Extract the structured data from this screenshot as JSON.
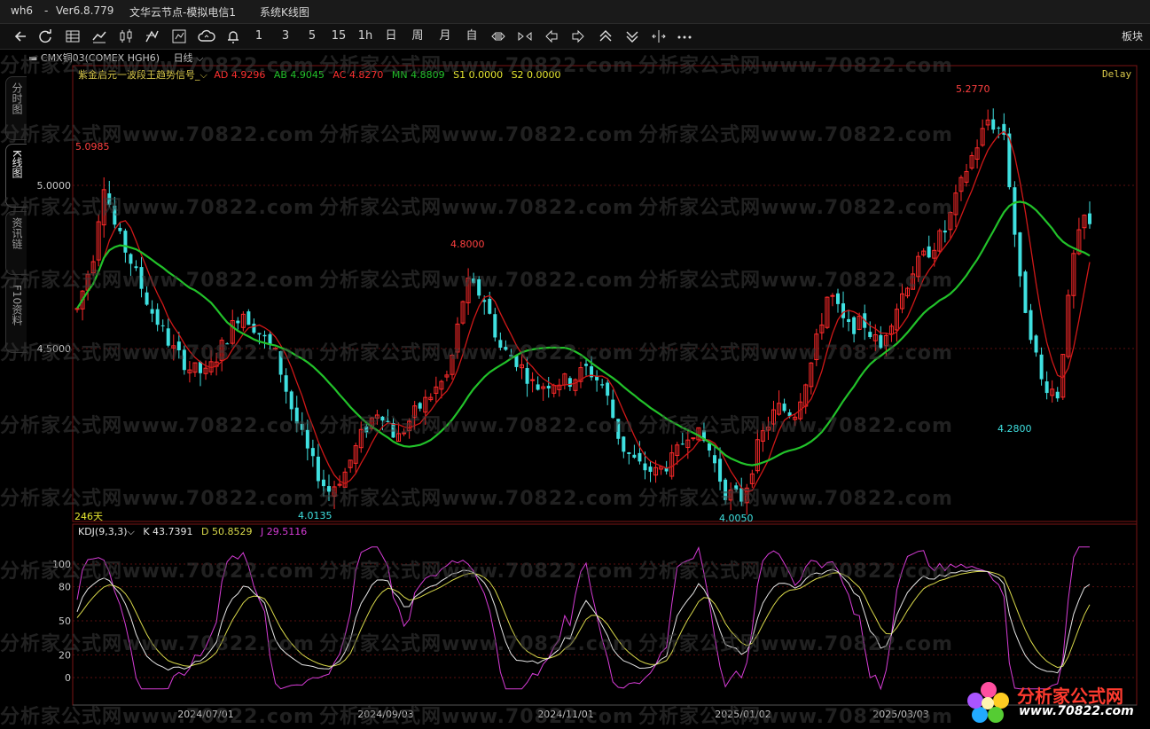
{
  "window": {
    "app": "wh6",
    "sep": "-",
    "version": "Ver6.8.779",
    "node": "文华云节点-模拟电信1",
    "view": "系统K线图"
  },
  "toolbar": {
    "items": [
      "1",
      "3",
      "5",
      "15",
      "1h",
      "日",
      "周",
      "月",
      "自"
    ],
    "right_label": "板块"
  },
  "sidebar": {
    "tabs": [
      "分时图",
      "K线图",
      "资讯链",
      "F10资料"
    ]
  },
  "instrument": {
    "name": "CMX铜03(COMEX HGH6)",
    "period": "日线"
  },
  "indicator_line": {
    "name": "紫金启元一波段王趋势信号",
    "ad": "AD 4.9296",
    "ab": "AB 4.9045",
    "ac": "AC 4.8270",
    "mn": "MN 4.8809",
    "s1": "S1 0.0000",
    "s2": "S2 0.0000",
    "delay": "Delay"
  },
  "price_axis": {
    "labels": [
      "5.0000",
      "4.5000"
    ],
    "values": [
      5.0,
      4.5
    ]
  },
  "annotations": {
    "high1": "5.0985",
    "high2": "4.8000",
    "high3": "5.2770",
    "low1": "4.0135",
    "low2": "4.0050",
    "low3": "4.2800",
    "days": "246天"
  },
  "kdj": {
    "label": "KDJ(9,3,3)",
    "k": "K 43.7391",
    "d": "D 50.8529",
    "j": "J 29.5116",
    "axis": [
      "100",
      "80",
      "50",
      "20",
      "0"
    ],
    "axis_values": [
      100,
      80,
      50,
      20,
      0
    ]
  },
  "dates": [
    "2024/07/01",
    "2024/09/03",
    "2024/11/01",
    "2025/01/02",
    "2025/03/03"
  ],
  "watermark": "分析家公式网www.70822.com",
  "logo": {
    "title": "分析家公式网",
    "url": "www.70822.com"
  },
  "colors": {
    "up": "#ff2a2a",
    "down": "#3fe0e0",
    "ma_green": "#22c22a",
    "ma_red": "#d01818",
    "k": "#e6e6e6",
    "d": "#d9d94a",
    "j": "#d63cd6",
    "grid": "#5a0f0f"
  }
}
